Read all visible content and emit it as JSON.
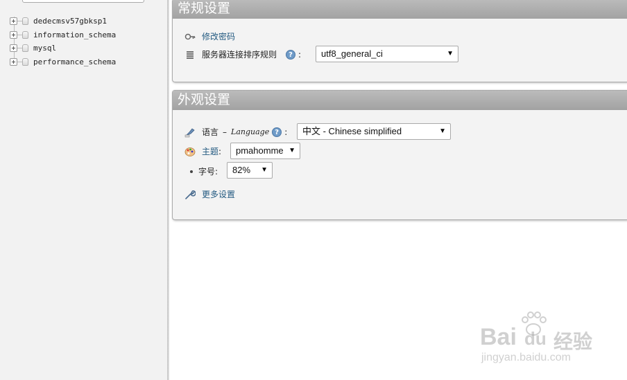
{
  "sidebar": {
    "databases": [
      {
        "name": "dedecmsv57gbksp1"
      },
      {
        "name": "information_schema"
      },
      {
        "name": "mysql"
      },
      {
        "name": "performance_schema"
      }
    ]
  },
  "general_settings": {
    "title": "常规设置",
    "change_password": "修改密码",
    "collation_label": "服务器连接排序规则",
    "collation_value": "utf8_general_ci"
  },
  "appearance_settings": {
    "title": "外观设置",
    "language_label": "语言",
    "language_label_en": "Language",
    "language_value": "中文 - Chinese simplified",
    "theme_label": "主题",
    "theme_value": "pmahomme",
    "font_size_label": "字号",
    "font_size_value": "82%",
    "more_settings": "更多设置"
  },
  "watermark": {
    "brand": "Bai",
    "brand2": "du",
    "cn": "经验",
    "url": "jingyan.baidu.com"
  },
  "colors": {
    "link": "#235a81",
    "panel_header": "#a9a9a9",
    "help_icon": "#6f9bc8"
  }
}
